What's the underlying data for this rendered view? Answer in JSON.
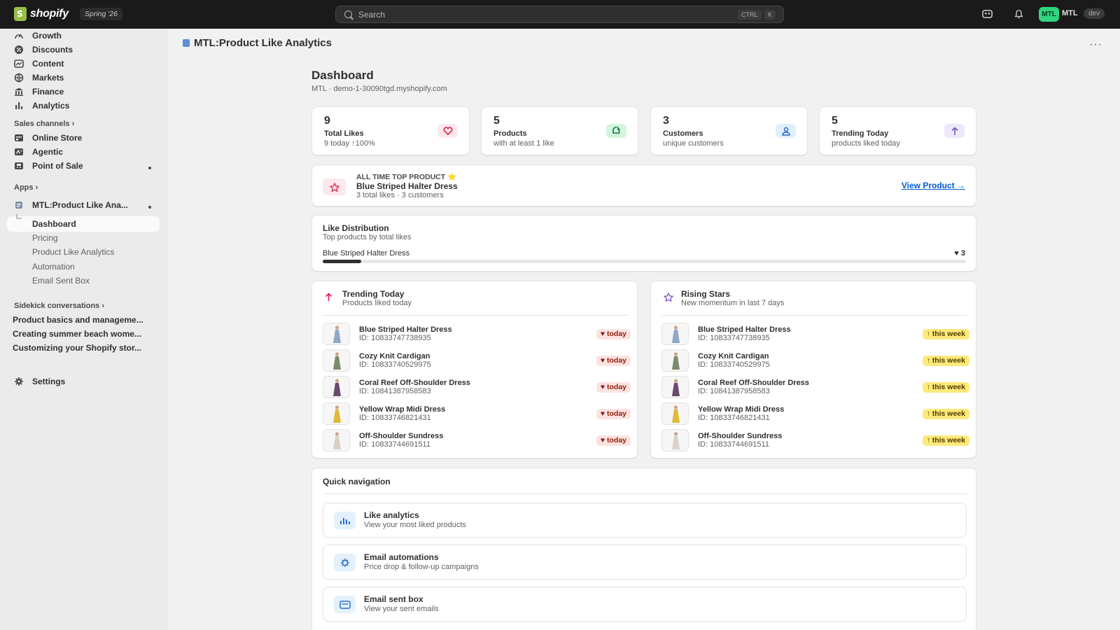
{
  "topbar": {
    "brand": "shopify",
    "edition": "Spring '26",
    "search_placeholder": "Search",
    "kbd_ctrl": "CTRL",
    "kbd_k": "K",
    "avatar_initials": "MTL",
    "store_name": "MTL",
    "env_badge": "dev"
  },
  "sidebar": {
    "nav": [
      {
        "label": "Growth",
        "icon": "growth-icon"
      },
      {
        "label": "Discounts",
        "icon": "discount-icon"
      },
      {
        "label": "Content",
        "icon": "content-icon"
      },
      {
        "label": "Markets",
        "icon": "globe-icon"
      },
      {
        "label": "Finance",
        "icon": "bank-icon"
      },
      {
        "label": "Analytics",
        "icon": "bar-chart-icon"
      }
    ],
    "sales_channels_heading": "Sales channels",
    "channels": [
      {
        "label": "Online Store",
        "icon": "store-icon"
      },
      {
        "label": "Agentic",
        "icon": "agentic-icon"
      },
      {
        "label": "Point of Sale",
        "icon": "pos-icon"
      }
    ],
    "apps_heading": "Apps",
    "app_name": "MTL:Product Like Ana...",
    "app_subitems": [
      "Dashboard",
      "Pricing",
      "Product Like Analytics",
      "Automation",
      "Email Sent Box"
    ],
    "sidekick_heading": "Sidekick conversations",
    "conversations": [
      "Product basics and manageme...",
      "Creating summer beach wome...",
      "Customizing your Shopify stor..."
    ],
    "settings_label": "Settings"
  },
  "main": {
    "app_title": "MTL:Product Like Analytics",
    "more_label": "···",
    "heading": "Dashboard",
    "subheading": "MTL · demo-1-30090tgd.myshopify.com",
    "stats": [
      {
        "value": "9",
        "label": "Total Likes",
        "sub": "9 today ↑100%",
        "icon": "heart-icon",
        "icon_bg": "#fde8ec",
        "icon_color": "#e51c4b"
      },
      {
        "value": "5",
        "label": "Products",
        "sub": "with at least 1 like",
        "icon": "tag-icon",
        "icon_bg": "#d4f5dd",
        "icon_color": "#0c7a43"
      },
      {
        "value": "3",
        "label": "Customers",
        "sub": "unique customers",
        "icon": "person-icon",
        "icon_bg": "#e0effd",
        "icon_color": "#2c6ecb"
      },
      {
        "value": "5",
        "label": "Trending Today",
        "sub": "products liked today",
        "icon": "arrow-up-icon",
        "icon_bg": "#efe8fb",
        "icon_color": "#7b55c7"
      }
    ],
    "top_product": {
      "kicker": "ALL TIME TOP PRODUCT ⭐",
      "name": "Blue Striped Halter Dress",
      "sub": "3 total likes · 3 customers",
      "link": "View Product →"
    },
    "distribution": {
      "title": "Like Distribution",
      "sub": "Top products by total likes",
      "product": "Blue Striped Halter Dress",
      "count": "♥ 3",
      "fill_fraction": 0.06
    },
    "trending": {
      "title": "Trending Today",
      "sub": "Products liked today",
      "badge": "♥ today",
      "items": [
        {
          "name": "Blue Striped Halter Dress",
          "id": "ID: 10833747738935"
        },
        {
          "name": "Cozy Knit Cardigan",
          "id": "ID: 10833740529975"
        },
        {
          "name": "Coral Reef Off-Shoulder Dress",
          "id": "ID: 10841387958583"
        },
        {
          "name": "Yellow Wrap Midi Dress",
          "id": "ID: 10833746821431"
        },
        {
          "name": "Off-Shoulder Sundress",
          "id": "ID: 10833744691511"
        }
      ]
    },
    "rising": {
      "title": "Rising Stars",
      "sub": "New momentum in last 7 days",
      "badge": "↑ this week",
      "items": [
        {
          "name": "Blue Striped Halter Dress",
          "id": "ID: 10833747738935"
        },
        {
          "name": "Cozy Knit Cardigan",
          "id": "ID: 10833740529975"
        },
        {
          "name": "Coral Reef Off-Shoulder Dress",
          "id": "ID: 10841387958583"
        },
        {
          "name": "Yellow Wrap Midi Dress",
          "id": "ID: 10833746821431"
        },
        {
          "name": "Off-Shoulder Sundress",
          "id": "ID: 10833744691511"
        }
      ]
    },
    "quick_nav": {
      "title": "Quick navigation",
      "items": [
        {
          "title": "Like analytics",
          "sub": "View your most liked products",
          "icon": "chart-icon"
        },
        {
          "title": "Email automations",
          "sub": "Price drop & follow-up campaigns",
          "icon": "gear-icon"
        },
        {
          "title": "Email sent box",
          "sub": "View your sent emails",
          "icon": "mail-icon"
        }
      ]
    }
  }
}
